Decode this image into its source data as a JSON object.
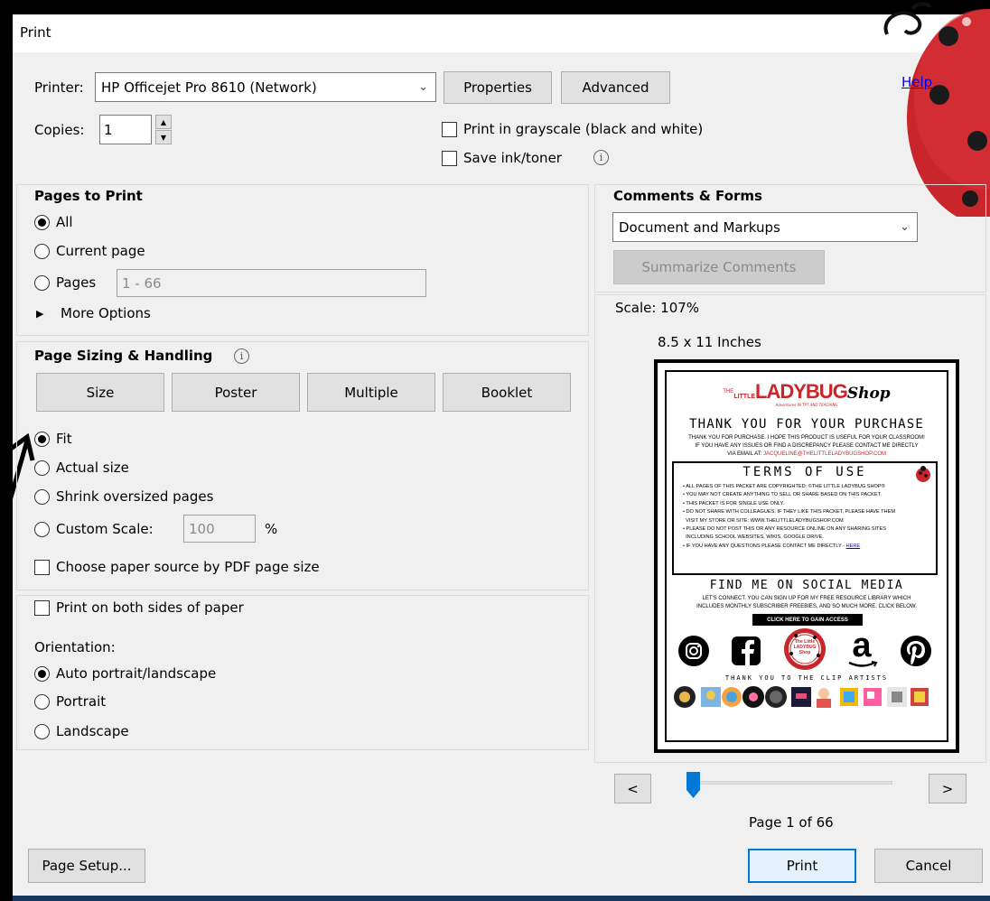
{
  "window": {
    "title": "Print",
    "help_link": "Help"
  },
  "printer": {
    "label": "Printer:",
    "selected": "HP Officejet Pro 8610 (Network)",
    "properties_button": "Properties",
    "advanced_button": "Advanced"
  },
  "copies": {
    "label": "Copies:",
    "value": "1"
  },
  "options": {
    "grayscale_label": "Print in grayscale (black and white)",
    "grayscale_checked": false,
    "save_ink_label": "Save ink/toner",
    "save_ink_checked": false
  },
  "pages_to_print": {
    "heading": "Pages to Print",
    "all": "All",
    "current_page": "Current page",
    "pages": "Pages",
    "pages_range_value": "1 - 66",
    "more_options": "More Options",
    "selected": "All"
  },
  "page_sizing": {
    "heading": "Page Sizing & Handling",
    "tabs": [
      "Size",
      "Poster",
      "Multiple",
      "Booklet"
    ],
    "fit": "Fit",
    "actual_size": "Actual size",
    "shrink": "Shrink oversized pages",
    "custom_scale": "Custom Scale:",
    "custom_scale_value": "100",
    "percent": "%",
    "choose_paper": "Choose paper source by PDF page size",
    "selected": "Fit"
  },
  "duplex": {
    "label": "Print on both sides of paper",
    "orientation_label": "Orientation:",
    "auto": "Auto portrait/landscape",
    "portrait": "Portrait",
    "landscape": "Landscape",
    "selected": "Auto portrait/landscape"
  },
  "comments_forms": {
    "heading": "Comments & Forms",
    "selected": "Document and Markups",
    "summarize_button": "Summarize Comments"
  },
  "preview": {
    "scale": "Scale: 107%",
    "paper_size": "8.5 x 11 Inches",
    "page_indicator": "Page 1 of 66",
    "prev": "<",
    "next": ">",
    "slider_fraction": 0.0
  },
  "footer": {
    "page_setup": "Page Setup...",
    "print": "Print",
    "cancel": "Cancel"
  },
  "document_preview": {
    "logo_the": "THE",
    "logo_little": "LITTLE",
    "logo_main": "LADYBUG",
    "logo_shop": "Shop",
    "logo_tagline": "Adventures IN TPT AND TEACHING",
    "thank_you_heading": "THANK YOU FOR YOUR PURCHASE",
    "thank_you_line1": "THANK YOU FOR PURCHASE. I HOPE THIS PRODUCT IS USEFUL FOR YOUR CLASSROOM!",
    "thank_you_line2": "IF YOU HAVE ANY ISSUES OR FIND A DISCREPANCY PLEASE CONTACT ME DIRECTLY",
    "thank_you_line3_prefix": "VIA EMAIL AT:",
    "thank_you_email": "JACQUELINE@THELITTLELADYBUGSHOP.COM",
    "terms_heading": "TERMS OF USE",
    "terms": [
      "ALL PAGES OF THIS PACKET ARE COPYRIGHTED: ©THE LITTLE LADYBUG SHOP®",
      "YOU MAY NOT CREATE ANYTHING TO SELL OR SHARE BASED ON THIS PACKET.",
      "THIS PACKET IS FOR SINGLE USE ONLY.",
      "DO NOT SHARE WITH COLLEAGUES. IF THEY LIKE THIS PACKET, PLEASE HAVE THEM",
      "VISIT MY STORE OR SITE: WWW.THELITTLELADYBUGSHOP.COM",
      "PLEASE DO NOT POST THIS OR ANY RESOURCE ONLINE ON ANY SHARING SITES",
      "INCLUDING SCHOOL WEBSITES, WIKIS, GOOGLE DRIVE.",
      "IF YOU HAVE ANY QUESTIONS PLEASE CONTACT ME DIRECTLY -"
    ],
    "terms_link": "HERE",
    "social_heading": "FIND ME ON SOCIAL MEDIA",
    "social_line1": "LET'S CONNECT. YOU CAN SIGN UP FOR MY FREE RESOURCE LIBRARY WHICH",
    "social_line2": "INCLUDES MONTHLY SUBSCRIBER FREEBIES, AND SO MUCH MORE. CLICK BELOW.",
    "social_cta": "CLICK HERE TO GAIN ACCESS",
    "center_badge": "The Little LADYBUG Shop",
    "clip_artists_heading": "THANK YOU TO THE CLIP ARTISTS"
  },
  "colors": {
    "accent": "#0078d7",
    "link": "#0000ee",
    "ladybug_red": "#c8262b",
    "dialog_bg": "#f0f0f0"
  }
}
